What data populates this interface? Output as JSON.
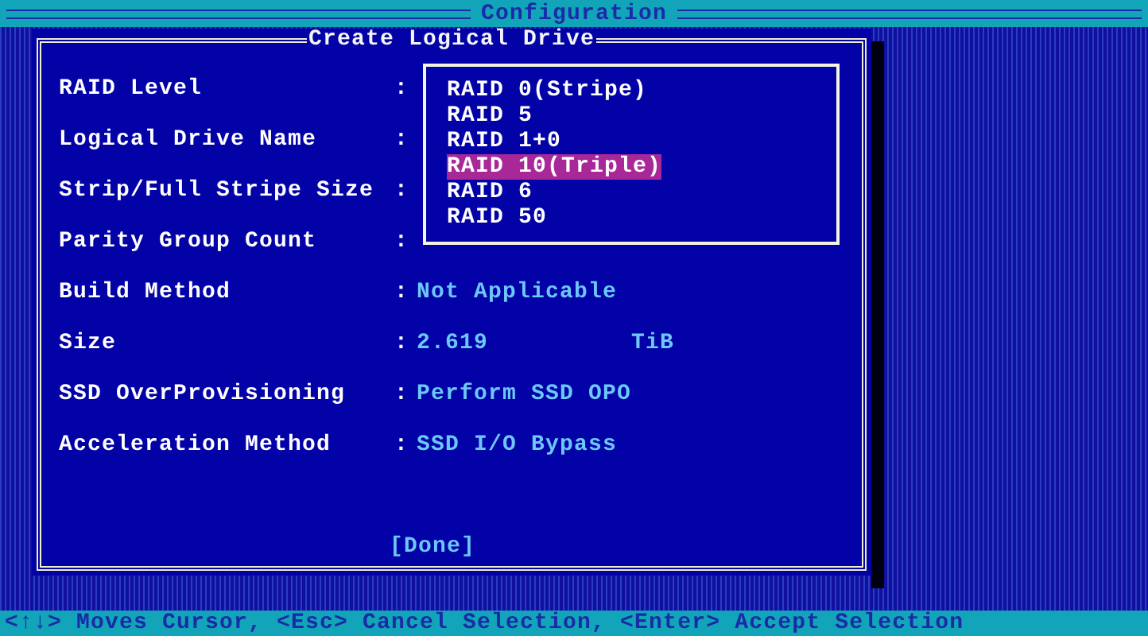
{
  "header": {
    "title": "Configuration"
  },
  "dialog": {
    "title": "Create Logical Drive",
    "fields": [
      {
        "label": "RAID Level",
        "separator": ":"
      },
      {
        "label": "Logical Drive Name",
        "separator": ":"
      },
      {
        "label": "Strip/Full Stripe Size",
        "separator": ":"
      },
      {
        "label": "Parity Group Count",
        "separator": ":"
      },
      {
        "label": "Build Method",
        "separator": ":",
        "value": "Not Applicable"
      },
      {
        "label": "Size",
        "separator": ":",
        "value": "2.619",
        "unit": "TiB"
      },
      {
        "label": "SSD OverProvisioning",
        "separator": ":",
        "value": "Perform SSD OPO"
      },
      {
        "label": "Acceleration Method",
        "separator": ":",
        "value": "SSD I/O Bypass"
      }
    ],
    "dropdown": [
      {
        "label": "RAID 0(Stripe)",
        "selected": false
      },
      {
        "label": "RAID 5",
        "selected": false
      },
      {
        "label": "RAID 1+0",
        "selected": false
      },
      {
        "label": "RAID 10(Triple)",
        "selected": true
      },
      {
        "label": "RAID 6",
        "selected": false
      },
      {
        "label": "RAID 50",
        "selected": false
      }
    ],
    "done_button": "[Done]"
  },
  "status_bar": "<↑↓> Moves Cursor, <Esc> Cancel Selection, <Enter> Accept Selection"
}
